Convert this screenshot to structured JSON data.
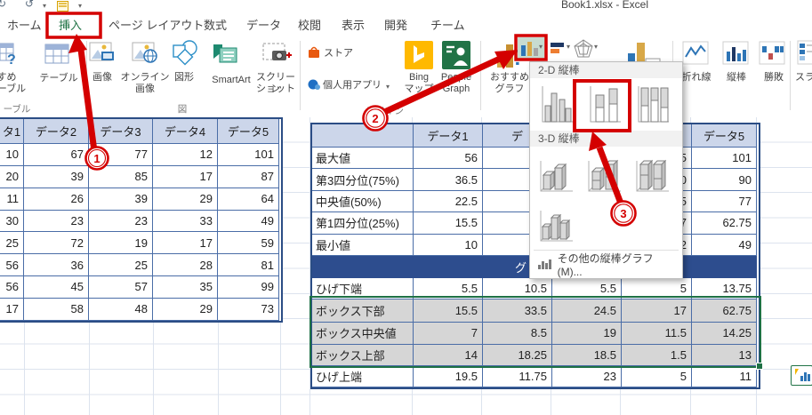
{
  "window": {
    "title": "Book1.xlsx - Excel"
  },
  "tabs": [
    "ホーム",
    "挿入",
    "ページ レイアウト",
    "数式",
    "データ",
    "校閲",
    "表示",
    "開発",
    "チーム"
  ],
  "ribbon": {
    "pivot_line1": "すすめ",
    "pivot_line2": "トテーブル",
    "tables_group_label": "ーブル",
    "table_btn": "テーブル",
    "illustrations_group_label": "図",
    "img": "画像",
    "online1": "オンライン",
    "online2": "画像",
    "shapes": "図形",
    "smartart": "SmartArt",
    "screen1": "スクリーン",
    "screen2": "ショット",
    "store": "ストア",
    "apps": "個人用アプリ",
    "bing1": "Bing",
    "bing2": "マップ",
    "people1": "People",
    "people2": "Graph",
    "reco1": "おすすめ",
    "reco2": "グラフ",
    "addins_group_label": "アドイン",
    "spark_line": "折れ線",
    "spark_col": "縦棒",
    "spark_wl": "勝敗",
    "spark_group_label": "スパークライン",
    "slicer_partial": "スラ"
  },
  "menu": {
    "section_2d": "2-D 縦棒",
    "section_3d": "3-D 縦棒",
    "more": "その他の縦棒グラフ(M)..."
  },
  "annotations": {
    "step1": "1",
    "step2": "2",
    "step3": "3"
  },
  "colors": {
    "annotation_red": "#d40000",
    "excel_green": "#217346",
    "header_bg": "#ccd6ea",
    "band_bg": "#2d4d8e"
  },
  "left_table": {
    "headers": [
      "タ1",
      "データ2",
      "データ3",
      "データ4",
      "データ5"
    ],
    "rows": [
      [
        10,
        67,
        77,
        12,
        101
      ],
      [
        20,
        39,
        85,
        17,
        87
      ],
      [
        11,
        26,
        39,
        29,
        64
      ],
      [
        30,
        23,
        23,
        33,
        49
      ],
      [
        25,
        72,
        19,
        17,
        59
      ],
      [
        56,
        36,
        25,
        28,
        81
      ],
      [
        56,
        45,
        57,
        35,
        99
      ],
      [
        17,
        58,
        48,
        29,
        73
      ]
    ]
  },
  "right_table": {
    "headers": [
      "",
      "データ1",
      "デ",
      "",
      "",
      "データ5"
    ],
    "stat_rows": [
      {
        "label": "最大値",
        "d1": "56",
        "d2": "",
        "d3": "",
        "d4": "5",
        "d5": "101"
      },
      {
        "label": "第3四分位(75%)",
        "d1": "36.5",
        "d2": "",
        "d3": "",
        "d4": "0",
        "d5": "90"
      },
      {
        "label": "中央値(50%)",
        "d1": "22.5",
        "d2": "",
        "d3": "",
        "d4": "5",
        "d5": "77"
      },
      {
        "label": "第1四分位(25%)",
        "d1": "15.5",
        "d2": "",
        "d3": "",
        "d4": "7",
        "d5": "62.75"
      },
      {
        "label": "最小値",
        "d1": "10",
        "d2": "",
        "d3": "",
        "d4": "2",
        "d5": "49"
      }
    ],
    "band_text": "グ",
    "box_rows": [
      {
        "label": "ひげ下端",
        "v1": "5.5",
        "v2": "10.5",
        "v3": "5.5",
        "v4": "5",
        "v5": "13.75"
      },
      {
        "label": "ボックス下部",
        "v1": "15.5",
        "v2": "33.5",
        "v3": "24.5",
        "v4": "17",
        "v5": "62.75"
      },
      {
        "label": "ボックス中央値",
        "v1": "7",
        "v2": "8.5",
        "v3": "19",
        "v4": "11.5",
        "v5": "14.25"
      },
      {
        "label": "ボックス上部",
        "v1": "14",
        "v2": "18.25",
        "v3": "18.5",
        "v4": "1.5",
        "v5": "13"
      },
      {
        "label": "ひげ上端",
        "v1": "19.5",
        "v2": "11.75",
        "v3": "23",
        "v4": "5",
        "v5": "11"
      }
    ]
  }
}
